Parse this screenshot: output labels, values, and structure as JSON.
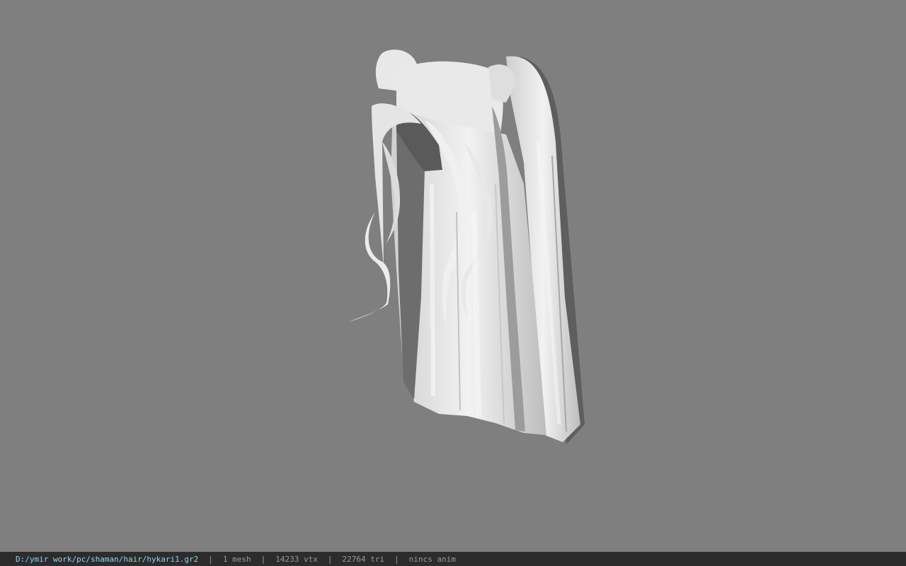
{
  "viewport": {
    "background_color": "#7f7f7f",
    "model_color": "#e6e6e6",
    "model_subject": "hair-model"
  },
  "statusbar": {
    "file_path": "D:/ymir work/pc/shaman/hair/hykari1.gr2",
    "separator": "|",
    "mesh_count": "1 mesh",
    "vertex_count": "14233 vtx",
    "triangle_count": "22764 tri",
    "anim_status": "nincs anim",
    "path_color": "#8fd4ee",
    "text_color": "#9a9a9a"
  }
}
